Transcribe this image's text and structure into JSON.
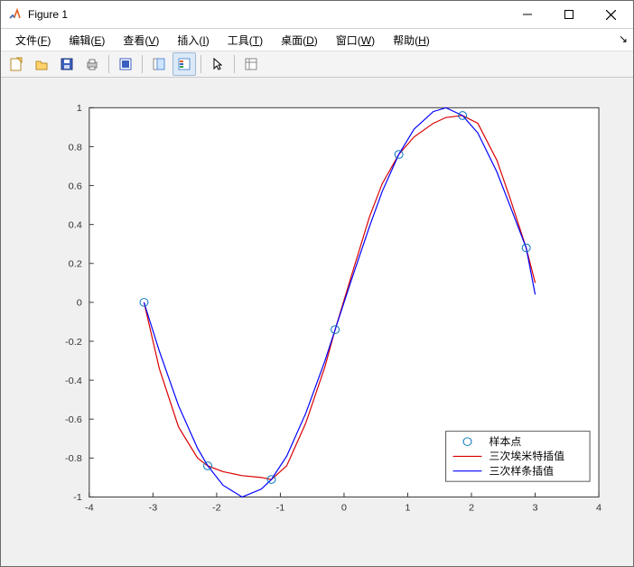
{
  "window": {
    "title": "Figure 1"
  },
  "menu": {
    "items": [
      {
        "label": "文件",
        "hotkey": "F"
      },
      {
        "label": "编辑",
        "hotkey": "E"
      },
      {
        "label": "查看",
        "hotkey": "V"
      },
      {
        "label": "插入",
        "hotkey": "I"
      },
      {
        "label": "工具",
        "hotkey": "T"
      },
      {
        "label": "桌面",
        "hotkey": "D"
      },
      {
        "label": "窗口",
        "hotkey": "W"
      },
      {
        "label": "帮助",
        "hotkey": "H"
      }
    ]
  },
  "toolbar": {
    "buttons": [
      {
        "name": "new-figure-icon"
      },
      {
        "name": "open-icon"
      },
      {
        "name": "save-icon"
      },
      {
        "name": "print-icon"
      },
      {
        "sep": true
      },
      {
        "name": "link-icon"
      },
      {
        "sep": true
      },
      {
        "name": "data-cursor-icon"
      },
      {
        "name": "colorbar-icon",
        "active": true
      },
      {
        "sep": true
      },
      {
        "name": "pointer-icon"
      },
      {
        "sep": true
      },
      {
        "name": "plot-tools-icon"
      }
    ]
  },
  "legend": {
    "items": [
      {
        "label": "样本点",
        "type": "marker"
      },
      {
        "label": "三次埃米特插值",
        "type": "line",
        "color": "#d90000"
      },
      {
        "label": "三次样条插值",
        "type": "line",
        "color": "#0000ff"
      }
    ]
  },
  "chart_data": {
    "type": "line",
    "xlabel": "",
    "ylabel": "",
    "xlim": [
      -4,
      4
    ],
    "ylim": [
      -1,
      1
    ],
    "xticks": [
      -4,
      -3,
      -2,
      -1,
      0,
      1,
      2,
      3,
      4
    ],
    "yticks": [
      -1,
      -0.8,
      -0.6,
      -0.4,
      -0.2,
      0,
      0.2,
      0.4,
      0.6,
      0.8,
      1
    ],
    "x": [
      -3.14,
      -2.14,
      -1.14,
      -0.14,
      0.86,
      1.86,
      2.86
    ],
    "samples": {
      "name": "样本点",
      "x": [
        -3.14,
        -2.14,
        -1.14,
        -0.14,
        0.86,
        1.86,
        2.86
      ],
      "y": [
        0.0,
        -0.84,
        -0.91,
        -0.14,
        0.76,
        0.96,
        0.28
      ]
    },
    "series": [
      {
        "name": "三次埃米特插值",
        "color": "#d90000",
        "x": [
          -3.14,
          -2.9,
          -2.6,
          -2.3,
          -2.14,
          -1.9,
          -1.6,
          -1.3,
          -1.14,
          -0.9,
          -0.6,
          -0.3,
          -0.14,
          0.1,
          0.4,
          0.6,
          0.86,
          1.1,
          1.4,
          1.6,
          1.86,
          2.1,
          2.4,
          2.6,
          2.86,
          3.0
        ],
        "y": [
          0.0,
          -0.34,
          -0.64,
          -0.8,
          -0.84,
          -0.87,
          -0.89,
          -0.9,
          -0.91,
          -0.84,
          -0.62,
          -0.33,
          -0.14,
          0.12,
          0.44,
          0.61,
          0.76,
          0.85,
          0.92,
          0.95,
          0.96,
          0.92,
          0.73,
          0.54,
          0.28,
          0.1
        ]
      },
      {
        "name": "三次样条插值",
        "color": "#0000ff",
        "x": [
          -3.14,
          -2.9,
          -2.6,
          -2.3,
          -2.14,
          -1.9,
          -1.6,
          -1.3,
          -1.14,
          -0.9,
          -0.6,
          -0.3,
          -0.14,
          0.1,
          0.4,
          0.6,
          0.86,
          1.1,
          1.4,
          1.6,
          1.86,
          2.1,
          2.4,
          2.6,
          2.86,
          3.0
        ],
        "y": [
          0.0,
          -0.25,
          -0.53,
          -0.75,
          -0.84,
          -0.94,
          -1.0,
          -0.96,
          -0.91,
          -0.79,
          -0.57,
          -0.3,
          -0.14,
          0.1,
          0.39,
          0.57,
          0.76,
          0.89,
          0.98,
          1.0,
          0.96,
          0.87,
          0.67,
          0.5,
          0.28,
          0.04
        ]
      }
    ]
  }
}
